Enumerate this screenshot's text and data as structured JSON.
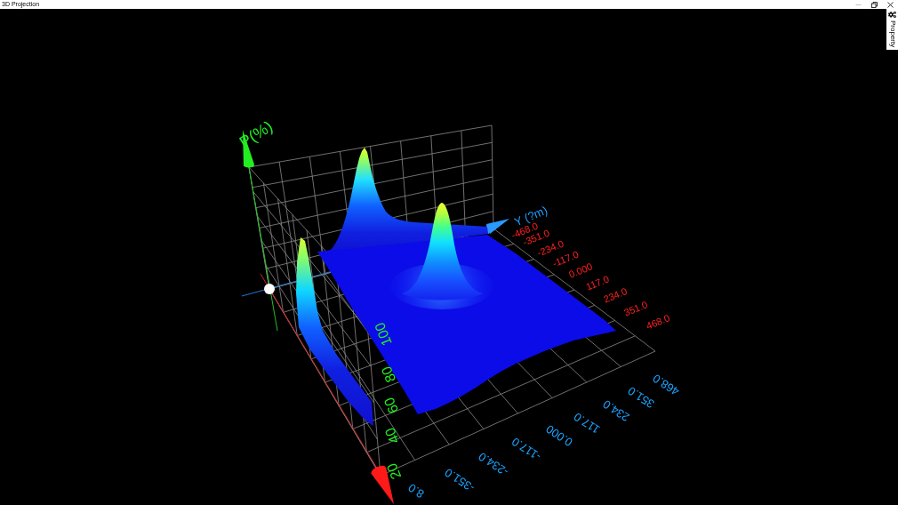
{
  "window": {
    "title": "3D Projection"
  },
  "dock": {
    "tabs": [
      {
        "label": "Property"
      }
    ]
  },
  "plot": {
    "z_axis": {
      "title": "P(%)",
      "ticks": [
        "100",
        "80",
        "60",
        "40",
        "20"
      ]
    },
    "y_axis": {
      "title": "Y (?m)",
      "ticks": [
        "-468.0",
        "-351.0",
        "-234.0",
        "-117.0",
        "0.000",
        "117.0",
        "234.0",
        "351.0",
        "468.0"
      ]
    },
    "x_axis": {
      "ticks": [
        "8.0",
        "-351.0",
        "-234.0",
        "-117.0",
        "0.000",
        "117.0",
        "234.0",
        "351.0",
        "468.0"
      ]
    }
  }
}
